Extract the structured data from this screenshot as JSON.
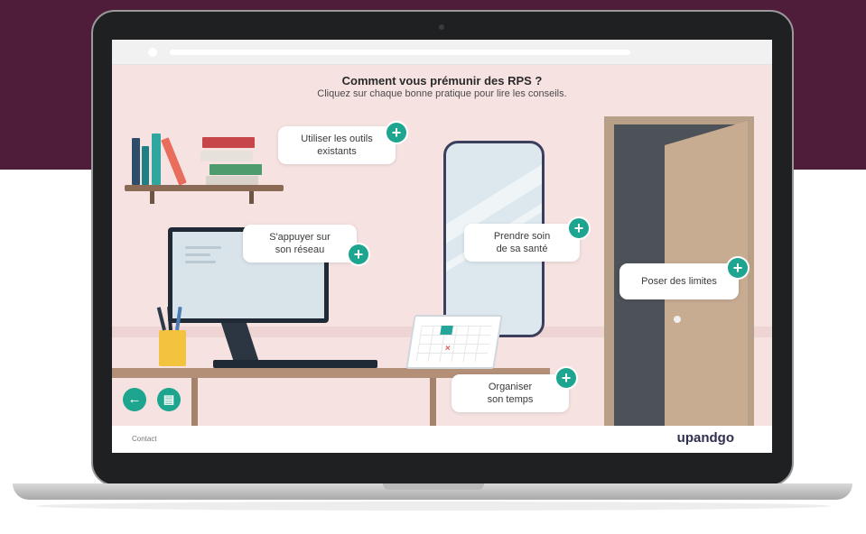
{
  "page": {
    "title": "Comment vous prémunir des RPS ?",
    "subtitle": "Cliquez sur chaque bonne pratique pour lire les conseils."
  },
  "hotspots": [
    {
      "label_line1": "Utiliser les outils",
      "label_line2": "existants",
      "icon": "plus-icon"
    },
    {
      "label_line1": "S'appuyer sur",
      "label_line2": "son réseau",
      "icon": "plus-icon"
    },
    {
      "label_line1": "Prendre soin",
      "label_line2": "de sa santé",
      "icon": "plus-icon"
    },
    {
      "label_line1": "Poser des limites",
      "label_line2": "",
      "icon": "plus-icon"
    },
    {
      "label_line1": "Organiser",
      "label_line2": "son temps",
      "icon": "plus-icon"
    }
  ],
  "nav": {
    "back_icon": "arrow-left-icon",
    "back_glyph": "←",
    "notes_icon": "transcript-icon",
    "notes_glyph": "▤",
    "plus_glyph": "+"
  },
  "footer": {
    "contact": "Contact",
    "logo": "upandgo"
  },
  "colors": {
    "accent": "#1ea58f",
    "wall": "#f6e3e1",
    "backdrop": "#4f1c3a"
  }
}
